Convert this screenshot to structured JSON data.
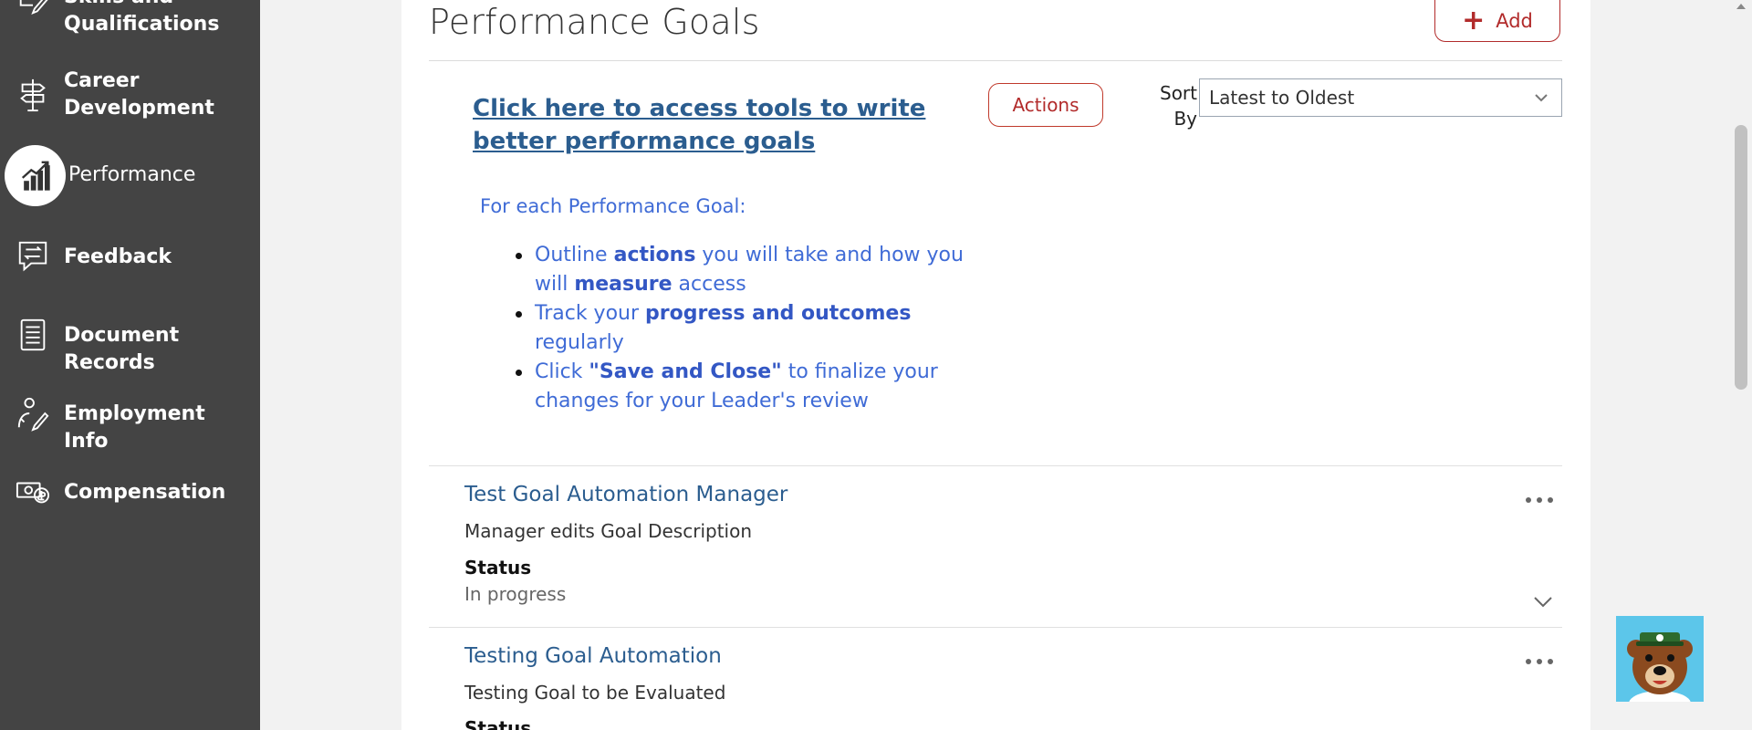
{
  "sidebar": {
    "items": [
      {
        "label": "Skills and Qualifications",
        "icon": "checklist-icon"
      },
      {
        "label": "Career Development",
        "icon": "signpost-icon"
      },
      {
        "label": "Performance",
        "icon": "chart-icon",
        "active": true
      },
      {
        "label": "Feedback",
        "icon": "feedback-icon"
      },
      {
        "label": "Document Records",
        "icon": "document-icon"
      },
      {
        "label": "Employment Info",
        "icon": "person-check-icon"
      },
      {
        "label": "Compensation",
        "icon": "money-icon"
      }
    ]
  },
  "main": {
    "title": "Performance Goals",
    "add_label": "Add",
    "tools_link": "Click here to access tools to write better performance goals",
    "actions_label": "Actions",
    "sort": {
      "label": "Sort By",
      "value": "Latest to Oldest"
    },
    "instructions": {
      "heading": "For each Performance Goal:",
      "bullets": [
        {
          "p1": "Outline ",
          "b1": "actions",
          "p2": " you will take and how you will ",
          "b2": "measure",
          "p3": " access"
        },
        {
          "p1": "Track your ",
          "b1": "progress and outcomes",
          "p2": " regularly"
        },
        {
          "p1": "Click ",
          "b1": "\"Save and Close\"",
          "p2": " to finalize your changes for your Leader's review"
        }
      ]
    },
    "goals": [
      {
        "title": "Test Goal Automation Manager",
        "description": "Manager edits Goal Description",
        "status_label": "Status",
        "status": "In progress"
      },
      {
        "title": "Testing Goal Automation",
        "description": "Testing Goal to be Evaluated",
        "status_label": "Status",
        "status": ""
      }
    ]
  },
  "colors": {
    "sidebar_bg": "#444444",
    "accent_red": "#b22b2b",
    "link_blue": "#2b5d8f",
    "instruction_blue": "#3f6bd6"
  }
}
